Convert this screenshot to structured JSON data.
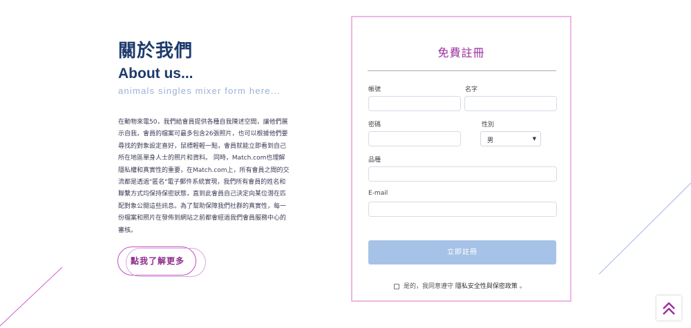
{
  "about": {
    "title_zh": "關於我們",
    "title_en": "About us...",
    "subtitle": "animals singles mixer form here...",
    "body": "在動物來電50，我們給會員提供各種自我陳述空間，讓他們展示自我，會員的檔案可最多包含26張照片，也可以根據他們要尋找的對象設定喜好，鼠標輕輕一點，會員就能立即看到自己所在地區單身人士的照片和資料。 同時，Match.com也理解隱私權和真實性的重要，在Match.com上，所有會員之間的交流都是透過\"匿名\"電子郵件系統實現，我們所有會員的姓名和聯繫方式均保持保密狀態，直到此會員自己決定向某位潛在匹配對象公開這些訊息。為了幫助保障我們社群的真實性，每一份檔案和照片在發佈到網站之前都會經過我們會員服務中心的審核。",
    "more_button": "點我了解更多"
  },
  "form": {
    "title": "免費註冊",
    "account_label": "帳號",
    "name_label": "名字",
    "password_label": "密碼",
    "gender_label": "性別",
    "gender_value": "男",
    "breed_label": "品種",
    "email_label": "E-mail",
    "submit_label": "立即註冊",
    "agree_prefix": "是的，我同意遵守",
    "agree_link": "隱私安全性與保密政策",
    "agree_suffix": "。"
  },
  "icons": {
    "back_to_top": "chevron-double-up-icon"
  },
  "colors": {
    "brand_purple": "#9b2fa0",
    "navy": "#1d3a6b",
    "submit_blue": "#a7c2e7",
    "card_border": "#ecb6e4"
  }
}
